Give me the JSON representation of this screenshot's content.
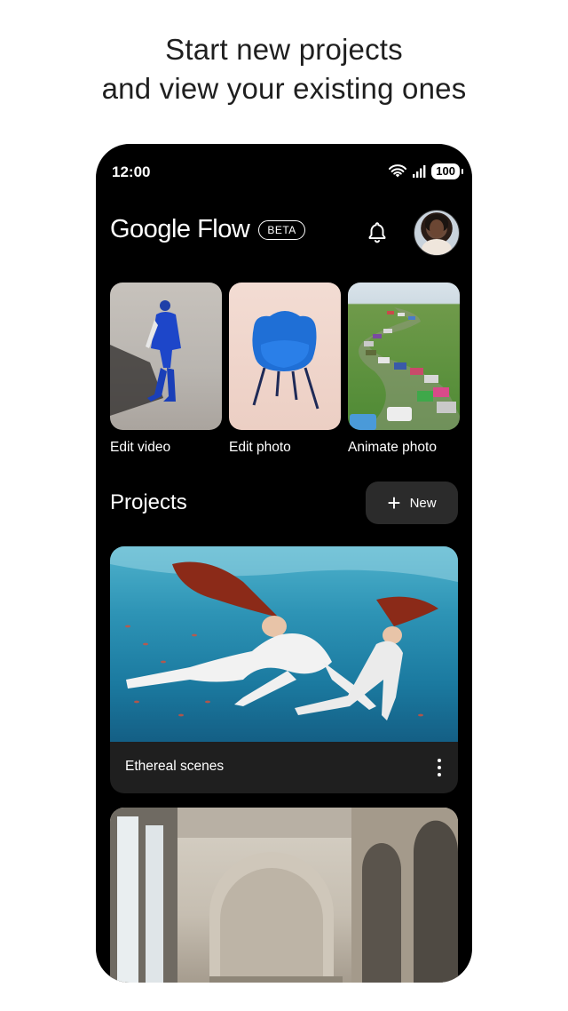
{
  "headline": {
    "line1": "Start new projects",
    "line2": "and view your existing ones"
  },
  "status_bar": {
    "time": "12:00",
    "battery": "100",
    "icons": [
      "wifi-icon",
      "signal-icon",
      "battery-icon"
    ]
  },
  "app": {
    "name": "Google Flow",
    "badge": "BETA",
    "notification_icon": "bell-icon",
    "avatar_icon": "profile-avatar"
  },
  "quick_actions": [
    {
      "label": "Edit video"
    },
    {
      "label": "Edit photo"
    },
    {
      "label": "Animate photo"
    }
  ],
  "projects": {
    "title": "Projects",
    "new_label": "New",
    "items": [
      {
        "title": "Ethereal scenes"
      },
      {
        "title": ""
      }
    ]
  },
  "colors": {
    "phone_background": "#000000",
    "card_background": "#1f1f1f",
    "button_background": "#2b2b2b",
    "text": "#ffffff",
    "headline_text": "#1f1f1f"
  }
}
